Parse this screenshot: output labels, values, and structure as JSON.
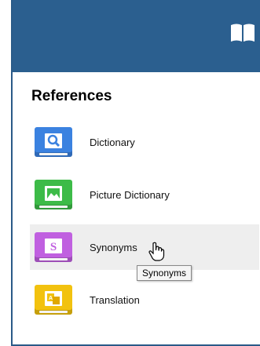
{
  "panel": {
    "title": "References"
  },
  "items": [
    {
      "label": "Dictionary",
      "icon": "magnifier-book-icon",
      "color": "#3b82e0"
    },
    {
      "label": "Picture Dictionary",
      "icon": "picture-book-icon",
      "color": "#3dbb48"
    },
    {
      "label": "Synonyms",
      "icon": "synonyms-book-icon",
      "color": "#c060e0",
      "glyph": "S"
    },
    {
      "label": "Translation",
      "icon": "translation-book-icon",
      "color": "#f2c20f"
    }
  ],
  "tooltip": {
    "text": "Synonyms"
  },
  "colors": {
    "topbar": "#2b5f8f"
  }
}
